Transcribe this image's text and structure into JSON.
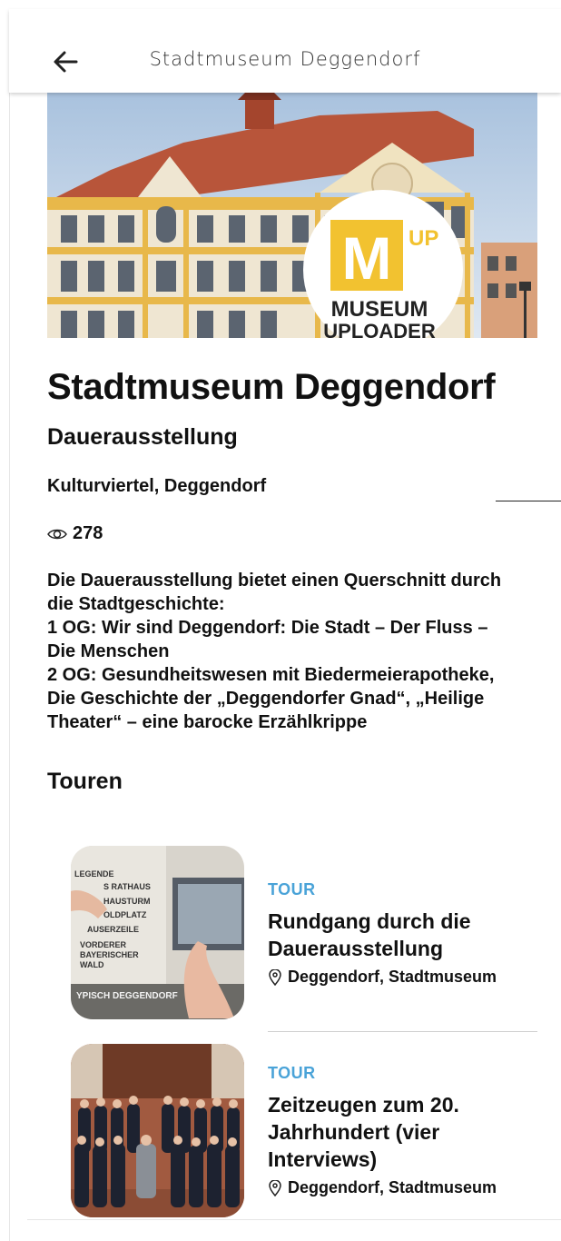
{
  "header": {
    "title": "Stadtmuseum Deggendorf",
    "back_icon": "arrow-left-icon"
  },
  "hero": {
    "logo_letter": "M",
    "logo_corner": "UP",
    "logo_line1": "MUSEUM",
    "logo_line2": "UPLOADER"
  },
  "main": {
    "title": "Stadtmuseum Deggendorf",
    "subtitle": "Dauerausstellung",
    "location": "Kulturviertel, Deggendorf",
    "views": "278",
    "views_icon": "eye-icon",
    "description_lines": [
      "Die Dauerausstellung bietet einen Querschnitt durch",
      "die Stadtgeschichte:",
      "1 OG: Wir sind Deggendorf: Die Stadt – Der Fluss –",
      "Die Menschen",
      "2 OG: Gesundheitswesen mit Biedermeierapotheke,",
      "Die Geschichte der „Deggendorfer Gnad“, „Heilige",
      "Theater“ – eine barocke Erzählkrippe"
    ],
    "section_title": "Touren"
  },
  "tours": [
    {
      "kind": "TOUR",
      "name_lines": [
        "Rundgang durch die",
        "Dauerausstellung"
      ],
      "location": "Deggendorf, Stadtmuseum",
      "thumb_texts": [
        "LEGENDE",
        "S RATHAUS",
        "HAUSTURM",
        "OLDPLATZ",
        "AUSERZEILE",
        "VORDERER",
        "BAYERISCHER",
        "WALD",
        "YPISCH DEGGENDORF"
      ]
    },
    {
      "kind": "TOUR",
      "name_lines": [
        "Zeitzeugen zum 20.",
        "Jahrhundert (vier",
        "Interviews)"
      ],
      "location": "Deggendorf, Stadtmuseum"
    }
  ],
  "colors": {
    "accent": "#4aa3d8",
    "logo_yellow": "#f2c230",
    "facade_yellow": "#e8b84a",
    "roof": "#c2593a"
  }
}
